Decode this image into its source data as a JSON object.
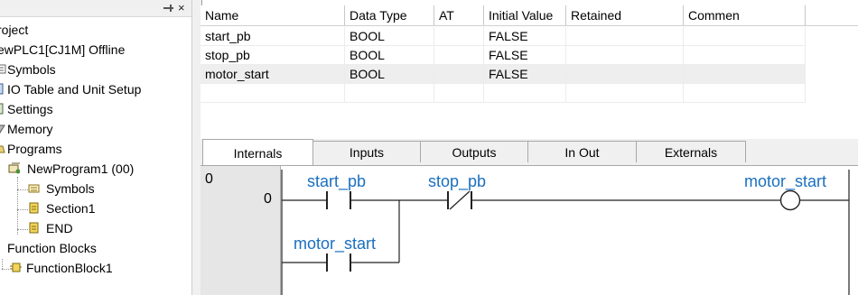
{
  "tree": {
    "close_glyph": "×",
    "nodes": [
      {
        "label": "roject",
        "icon": "project-icon"
      },
      {
        "label": "ewPLC1[CJ1M] Offline",
        "icon": "plc-icon"
      },
      {
        "label": "Symbols",
        "icon": "symbols-icon"
      },
      {
        "label": "IO Table and Unit Setup",
        "icon": "io-table-icon"
      },
      {
        "label": "Settings",
        "icon": "settings-icon"
      },
      {
        "label": "Memory",
        "icon": "memory-icon"
      },
      {
        "label": "Programs",
        "icon": "programs-icon"
      },
      {
        "label": "NewProgram1 (00)",
        "icon": "program-icon"
      },
      {
        "label": "Symbols",
        "icon": "local-symbols-icon"
      },
      {
        "label": "Section1",
        "icon": "section-icon"
      },
      {
        "label": "END",
        "icon": "end-section-icon"
      },
      {
        "label": "Function Blocks",
        "icon": "function-blocks-icon"
      },
      {
        "label": "FunctionBlock1",
        "icon": "function-block-icon"
      }
    ]
  },
  "variables": {
    "columns": [
      "Name",
      "Data Type",
      "AT",
      "Initial Value",
      "Retained",
      "Commen"
    ],
    "rows": [
      {
        "name": "start_pb",
        "type": "BOOL",
        "at": "",
        "initial": "FALSE",
        "retained": "",
        "comment": ""
      },
      {
        "name": "stop_pb",
        "type": "BOOL",
        "at": "",
        "initial": "FALSE",
        "retained": "",
        "comment": ""
      },
      {
        "name": "motor_start",
        "type": "BOOL",
        "at": "",
        "initial": "FALSE",
        "retained": "",
        "comment": ""
      }
    ]
  },
  "tabs": [
    "Internals",
    "Inputs",
    "Outputs",
    "In Out",
    "Externals"
  ],
  "active_tab": "Internals",
  "ladder": {
    "rung_number": "0",
    "step_number": "0",
    "contact1": "start_pb",
    "contact2": "stop_pb",
    "coil": "motor_start",
    "branch_contact": "motor_start"
  },
  "colors": {
    "ladder_label": "#1a6fbf",
    "selected_row": "#eeeeee"
  }
}
